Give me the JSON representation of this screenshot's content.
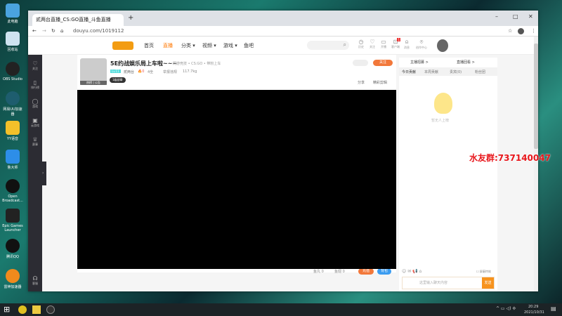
{
  "desktop": {
    "icons": [
      "此电脑",
      "回收站",
      "OBS Studio",
      "网易UU加速器",
      "YY语音",
      "鲁大师",
      "Open Broadcast...",
      "Epic Games Launcher",
      "腾讯QQ",
      "雷神加速器"
    ]
  },
  "browser": {
    "tab_title": "贰两台直播_CS:GO直播_斗鱼直播",
    "url": "douyu.com/1019112",
    "new_tab": "+",
    "minimize": "–",
    "maximize": "□",
    "close": "✕"
  },
  "site": {
    "nav": [
      "首页",
      "直播",
      "分类 ▾",
      "视频 ▾",
      "游戏 ▾",
      "鱼吧"
    ],
    "header_icons": [
      {
        "icon": "history-icon",
        "label": "历史"
      },
      {
        "icon": "heart-icon",
        "label": "关注"
      },
      {
        "icon": "live-icon",
        "label": "开播"
      },
      {
        "icon": "gift-icon",
        "label": "客户端",
        "badge": "1"
      },
      {
        "icon": "bell-icon",
        "label": "消息"
      },
      {
        "icon": "location-icon",
        "label": "创作中心"
      }
    ],
    "sidebar": [
      "关注",
      "排行榜",
      "游戏",
      "云游戏",
      "赛事",
      "客服"
    ],
    "room": {
      "title": "5E约战娱乐局上车啦~~~",
      "category": "网游竞技 • CS:GO • 带粉上车",
      "level_badge": "Lv.11",
      "streamer": "贰两台",
      "heat": "0",
      "followers": "4坐",
      "report": "举报违规",
      "weight": "117.7kg",
      "avatar_tag": "热榜 | 公告",
      "fan_badge": "1级勋章",
      "follow_label": "关注",
      "share": "分享",
      "clip": "精彩剪辑"
    },
    "right": {
      "links": [
        "主播招募 >",
        "直播回看 >"
      ],
      "tabs": [
        "今日贡献",
        "本周贡献",
        "贵宾(0)",
        "粉丝团"
      ],
      "empty_text": "暂无人上榜",
      "block_effects": "屏蔽特效",
      "chat_placeholder": "这里输入聊天内容",
      "send": "发送"
    },
    "player_bottom": {
      "items": [
        "鱼丸 0",
        "鱼翅 0"
      ],
      "recharge": "充值",
      "backpack": "背包"
    }
  },
  "watermark": "水友群:737140047",
  "taskbar": {
    "time": "20:29",
    "date": "2021/10/31"
  }
}
